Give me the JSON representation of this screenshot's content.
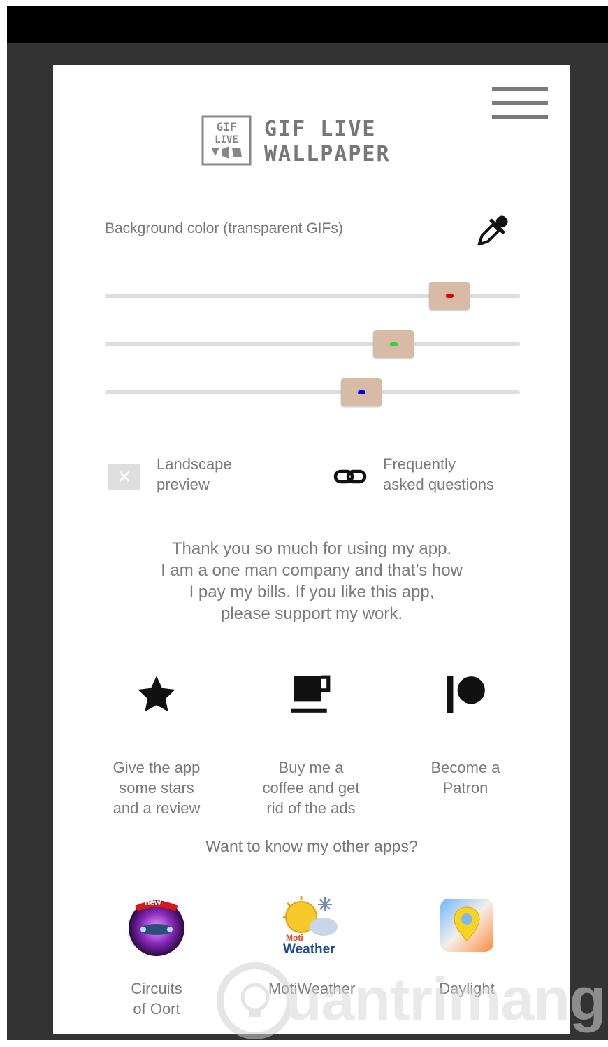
{
  "app": {
    "logo_box_lines": [
      "GIF",
      "LIVE"
    ],
    "title_lines": [
      "GIF LIVE",
      "WALLPAPER"
    ]
  },
  "background": {
    "label": "Background color (transparent GIFs)"
  },
  "sliders": [
    {
      "name": "red",
      "value": 0.83,
      "indicator_color": "#e00000"
    },
    {
      "name": "green",
      "value": 0.695,
      "indicator_color": "#22dd22"
    },
    {
      "name": "blue",
      "value": 0.618,
      "indicator_color": "#0000dd"
    }
  ],
  "options": {
    "landscape_preview_lines": [
      "Landscape",
      "preview"
    ],
    "landscape_checked": false,
    "faq_lines": [
      "Frequently",
      "asked questions"
    ]
  },
  "thanks_lines": [
    "Thank you so much for using my app.",
    "I am a one man company and that’s how",
    "I pay my bills. If you like this app,",
    "please support my work."
  ],
  "actions": [
    {
      "icon": "star-icon",
      "lines": [
        "Give the app",
        "some stars",
        "and a review"
      ]
    },
    {
      "icon": "coffee-icon",
      "lines": [
        "Buy me a",
        "coffee and get",
        "rid of the ads"
      ]
    },
    {
      "icon": "patreon-icon",
      "lines": [
        "Become a",
        "Patron"
      ]
    }
  ],
  "other_apps": {
    "title": "Want to know my other apps?",
    "items": [
      {
        "lines": [
          "Circuits",
          "of Oort"
        ],
        "badge": "new"
      },
      {
        "lines": [
          "MotiWeather"
        ],
        "icon_text": [
          "Moti",
          "Weather"
        ]
      },
      {
        "lines": [
          "Daylight"
        ]
      }
    ]
  },
  "watermark": {
    "text": "uantrimang"
  },
  "colors": {
    "frame": "#333333",
    "text": "#7b7b7b",
    "thumb": "#d7bba7"
  }
}
